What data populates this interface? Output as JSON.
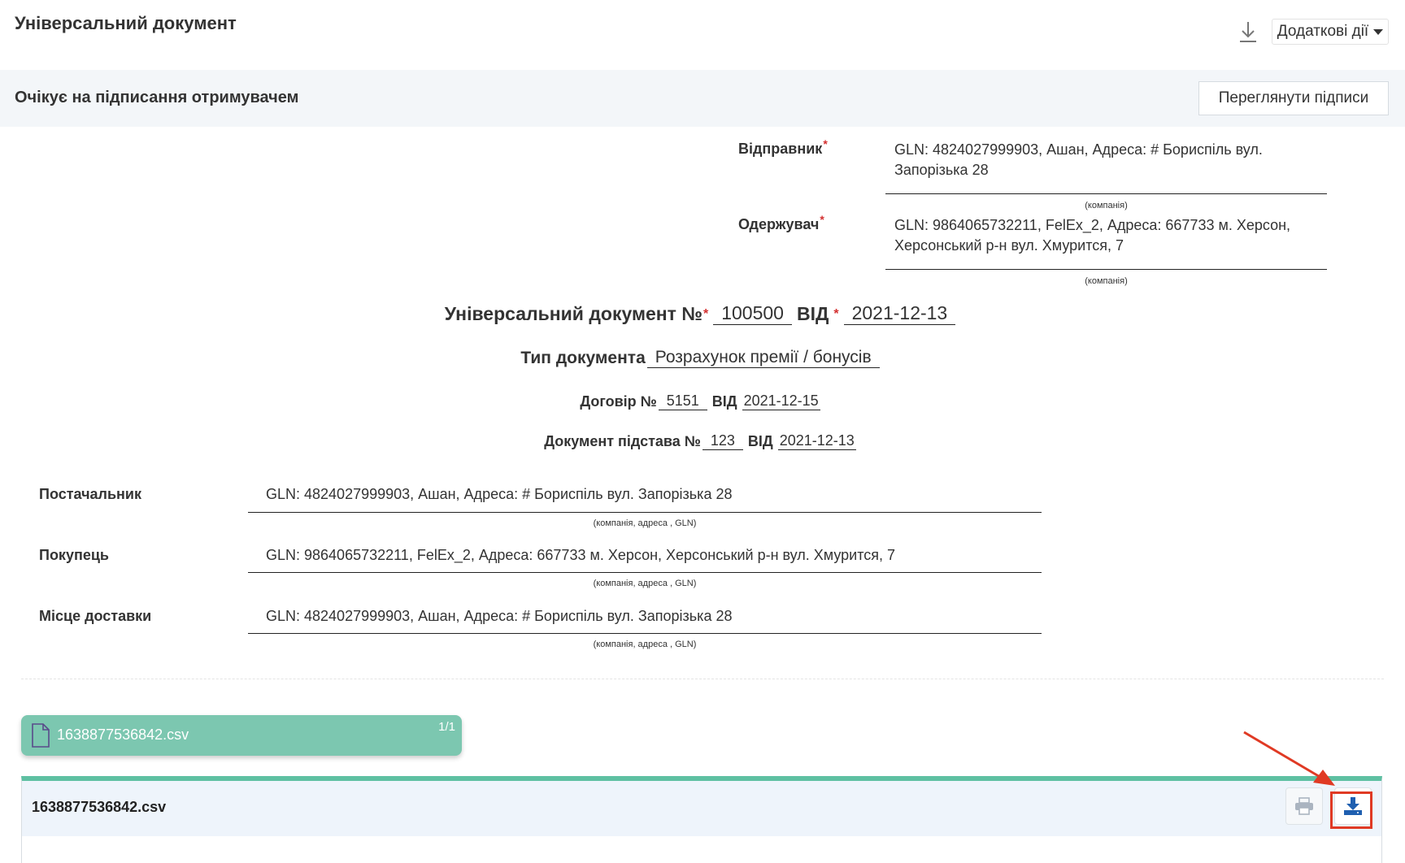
{
  "header": {
    "title": "Універсальний документ",
    "download_icon": "download-icon",
    "actions_label": "Додаткові дії"
  },
  "status": {
    "text": "Очікує на підписання отримувачем",
    "view_signatures_label": "Переглянути підписи"
  },
  "sender": {
    "label": "Відправник",
    "required_mark": "*",
    "value": "GLN: 4824027999903, Ашан, Адреса: # Бориспіль вул. Запорізька 28",
    "hint": "(компанія)"
  },
  "recipient": {
    "label": "Одержувач",
    "required_mark": "*",
    "value": "GLN: 9864065732211, FelEx_2, Адреса: 667733 м. Херсон, Херсонський р-н вул. Хмурится, 7",
    "hint": "(компанія)"
  },
  "document": {
    "title_label": "Універсальний документ №",
    "required_mark": "*",
    "number": "100500",
    "from_label": "ВІД",
    "date": "2021-12-13",
    "type_label": "Тип документа",
    "type_value": "Розрахунок премії / бонусів",
    "contract_label": "Договір №",
    "contract_number": "5151",
    "contract_from_label": "ВІД",
    "contract_date": "2021-12-15",
    "basis_label": "Документ підстава №",
    "basis_number": "123",
    "basis_from_label": "ВІД",
    "basis_date": "2021-12-13"
  },
  "parties": [
    {
      "label": "Постачальник",
      "value": "GLN: 4824027999903, Ашан, Адреса: # Бориспіль вул. Запорізька 28",
      "hint": "(компанія, адреса , GLN)"
    },
    {
      "label": "Покупець",
      "value": "GLN: 9864065732211, FelEx_2, Адреса: 667733 м. Херсон, Херсонський р-н вул. Хмурится, 7",
      "hint": "(компанія, адреса , GLN)"
    },
    {
      "label": "Місце доставки",
      "value": "GLN: 4824027999903, Ашан, Адреса: # Бориспіль вул. Запорізька 28",
      "hint": "(компанія, адреса , GLN)"
    }
  ],
  "attachments": {
    "tab_name": "1638877536842.csv",
    "tab_count": "1/1",
    "viewer_name": "1638877536842.csv",
    "print_icon": "printer-icon",
    "download_icon": "download-tray-icon"
  },
  "colors": {
    "accent_green": "#5ec0a2",
    "tab_green": "#7cc7b0",
    "annotation_red": "#e03a24",
    "required_red": "#d32f2f",
    "download_blue": "#1f5fb0"
  }
}
